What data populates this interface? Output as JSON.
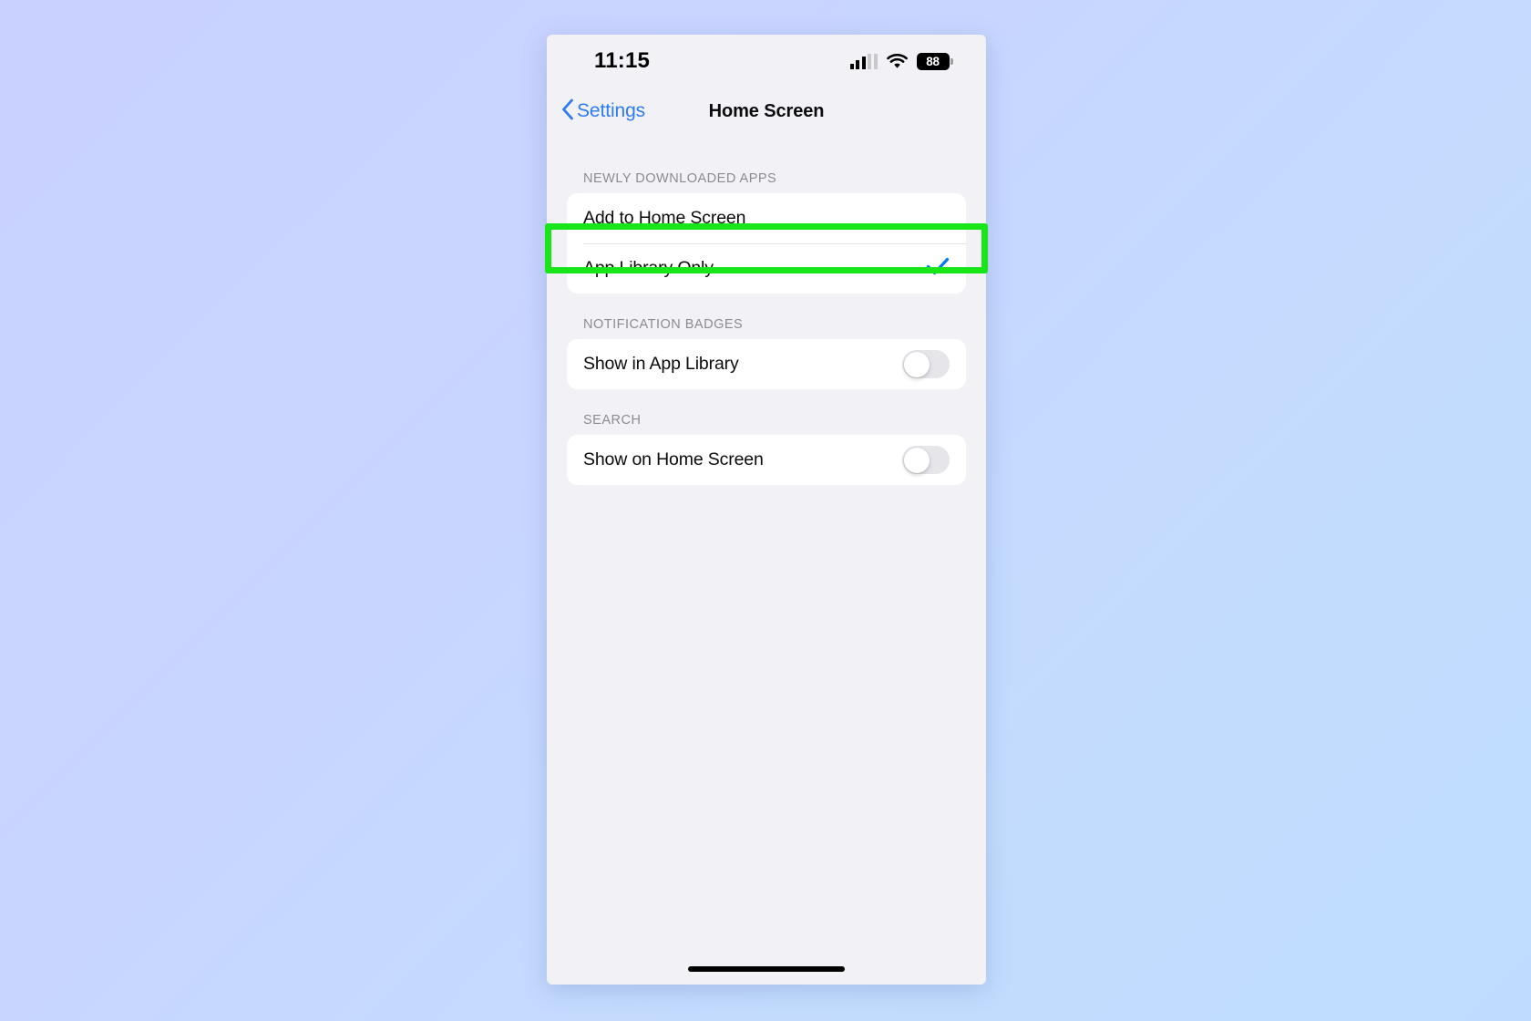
{
  "status_bar": {
    "time": "11:15",
    "cellular_icon": "cellular-signal-icon",
    "wifi_icon": "wifi-icon",
    "battery_percent": "88"
  },
  "nav": {
    "back_label": "Settings",
    "back_icon": "chevron-left-icon",
    "title": "Home Screen"
  },
  "sections": [
    {
      "header": "NEWLY DOWNLOADED APPS",
      "rows": [
        {
          "label": "Add to Home Screen",
          "type": "option",
          "selected": false
        },
        {
          "label": "App Library Only",
          "type": "option",
          "selected": true,
          "accessory_icon": "checkmark-icon"
        }
      ]
    },
    {
      "header": "NOTIFICATION BADGES",
      "rows": [
        {
          "label": "Show in App Library",
          "type": "toggle",
          "value": "off"
        }
      ]
    },
    {
      "header": "SEARCH",
      "rows": [
        {
          "label": "Show on Home Screen",
          "type": "toggle",
          "value": "off"
        }
      ]
    }
  ],
  "annotation": {
    "highlight_color": "#19e619",
    "target": "App Library Only"
  },
  "colors": {
    "accent_blue": "#007aff",
    "link_blue": "#2d7bf6",
    "background_start": "#c9d2ff",
    "background_end": "#bfdcfe",
    "screen_background": "#f2f1f6",
    "row_background": "#ffffff",
    "switch_off": "#e5e5ea"
  },
  "home_indicator": "home-indicator"
}
